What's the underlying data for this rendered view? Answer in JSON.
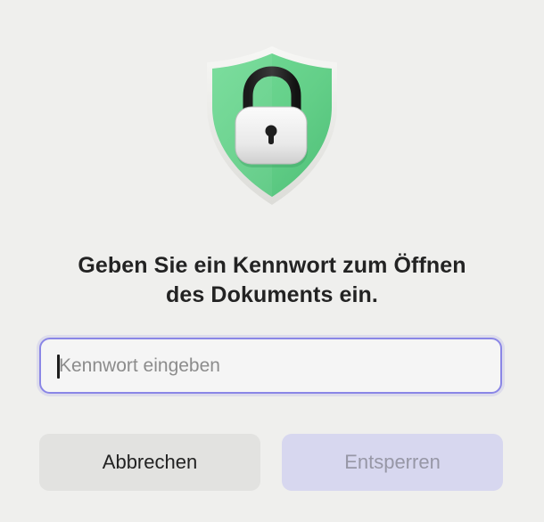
{
  "dialog": {
    "icon": "shield-lock-icon",
    "message_line1": "Geben Sie ein Kennwort zum Öffnen",
    "message_line2": "des Dokuments ein.",
    "password": {
      "value": "",
      "placeholder": "Kennwort eingeben"
    },
    "buttons": {
      "cancel_label": "Abbrechen",
      "unlock_label": "Entsperren"
    }
  },
  "colors": {
    "background": "#efefed",
    "shield_green": "#66d48c",
    "focus_ring": "#8a86e6",
    "unlock_button_disabled": "#d7d7ef"
  }
}
